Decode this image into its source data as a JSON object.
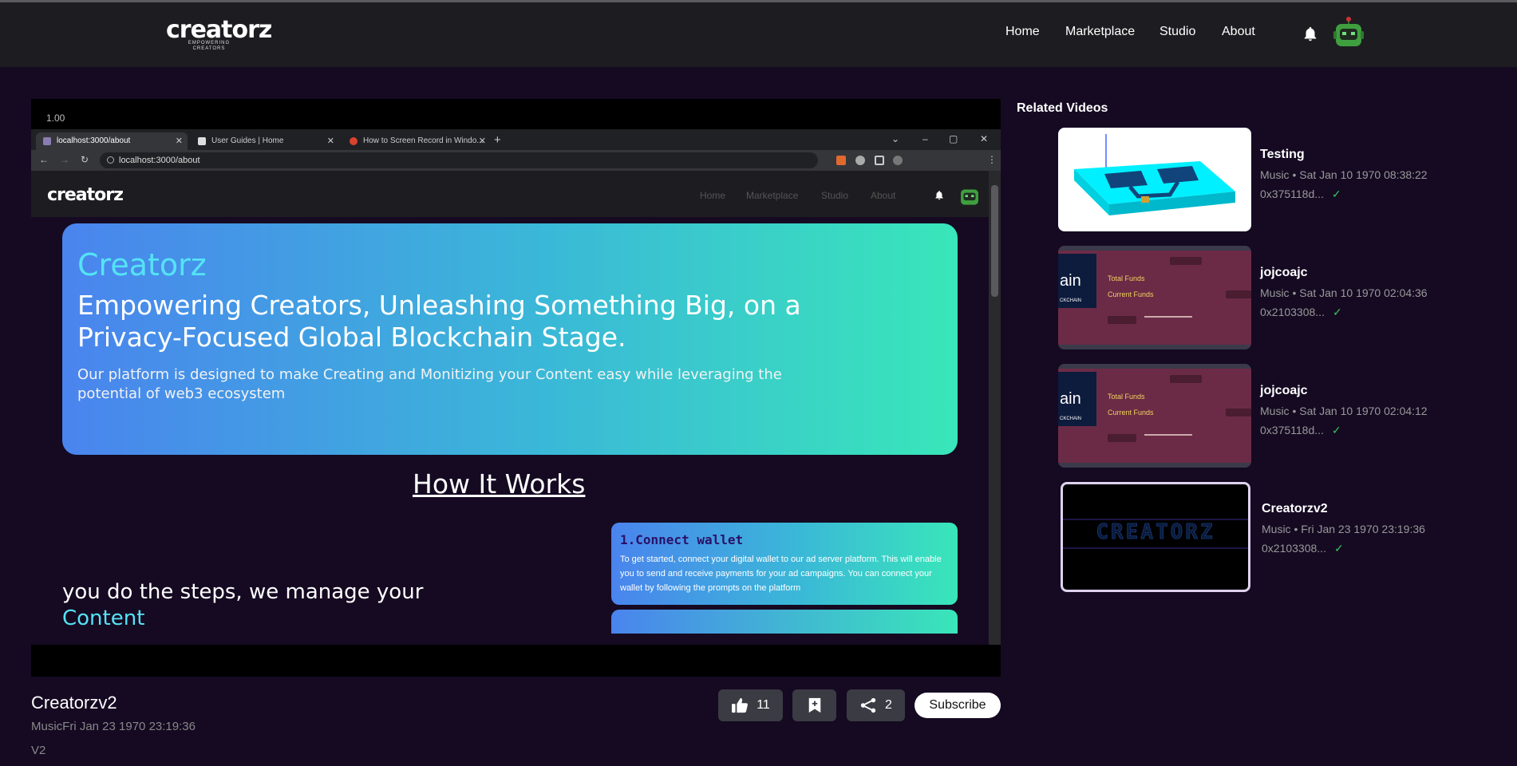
{
  "brand": {
    "logo_word": "creatorz",
    "logo_tag": "EMPOWERING CREATORS"
  },
  "nav": {
    "items": [
      "Home",
      "Marketplace",
      "Studio",
      "About"
    ]
  },
  "player": {
    "speed": "1.00",
    "browser": {
      "tabs": [
        "localhost:3000/about",
        "User Guides | Home",
        "How to Screen Record in Windo..."
      ],
      "url": "localhost:3000/about"
    },
    "site": {
      "logo_word": "creatorz",
      "nav": [
        "Home",
        "Marketplace",
        "Studio",
        "About"
      ],
      "hero_title": "Creatorz",
      "hero_subtitle": "Empowering Creators, Unleashing Something Big, on a Privacy-Focused Global Blockchain Stage.",
      "hero_desc": "Our platform is designed to make Creating and Monitizing your Content easy while leveraging the potential of web3 ecosystem",
      "how_heading": "How It Works",
      "steps_left_1": "you do the steps, we manage your",
      "steps_left_2": "Content",
      "step1_title": "1.Connect wallet",
      "step1_text": "To get started, connect your digital wallet to our ad server platform. This will enable you to send and receive payments for your ad campaigns. You can connect your wallet by following the prompts on the platform"
    }
  },
  "video": {
    "title": "Creatorzv2",
    "meta": "MusicFri Jan 23 1970 23:19:36",
    "description": "V2",
    "likes": "11",
    "shares": "2",
    "subscribe_label": "Subscribe"
  },
  "related": {
    "heading": "Related Videos",
    "items": [
      {
        "title": "Testing",
        "meta": "Music • Sat Jan 10 1970 08:38:22",
        "addr": "0x375118d...",
        "thumb": "cad-model"
      },
      {
        "title": "jojcoajc",
        "meta": "Music • Sat Jan 10 1970 02:04:36",
        "addr": "0x2103308...",
        "thumb": "funds-dashboard"
      },
      {
        "title": "jojcoajc",
        "meta": "Music • Sat Jan 10 1970 02:04:12",
        "addr": "0x375118d...",
        "thumb": "funds-dashboard"
      },
      {
        "title": "Creatorzv2",
        "meta": "Music • Fri Jan 23 1970 23:19:36",
        "addr": "0x2103308...",
        "thumb": "creatorz-dark"
      }
    ],
    "thumb_text": {
      "chain": "ain",
      "chain_sub": "CKCHAIN",
      "total_funds": "Total Funds",
      "current_funds": "Current Funds",
      "creatorz_banner": "CREATORZ"
    }
  },
  "colors": {
    "background": "#150a22",
    "topbar": "#1d1d21",
    "accent": "#55e3f6",
    "verified": "#3fbf5f"
  }
}
